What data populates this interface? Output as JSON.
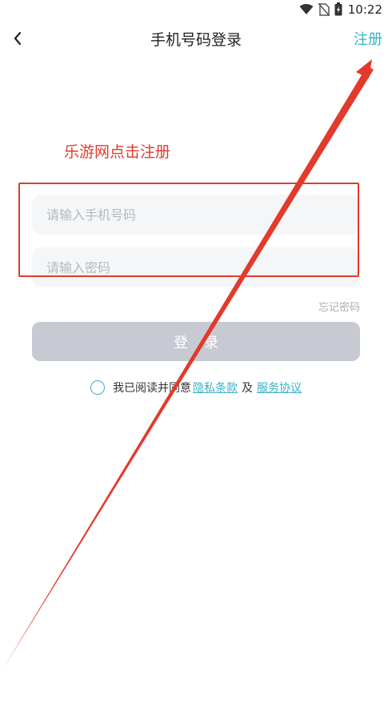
{
  "status_bar": {
    "time": "10:22"
  },
  "header": {
    "back_icon": "chevron-left-icon",
    "title": "手机号码登录",
    "register_label": "注册"
  },
  "annotation": {
    "text": "乐游网点击注册",
    "color": "#e23a2c"
  },
  "form": {
    "phone_placeholder": "请输入手机号码",
    "password_placeholder": "请输入密码",
    "forgot_label": "忘记密码",
    "login_label": "登录"
  },
  "agreement": {
    "prefix": "我已阅读并同意",
    "privacy_label": "隐私条款",
    "and": "及",
    "service_label": "服务协议"
  },
  "colors": {
    "accent": "#3cb0c5",
    "button_disabled": "#c7cad3",
    "annotation": "#e23a2c"
  }
}
